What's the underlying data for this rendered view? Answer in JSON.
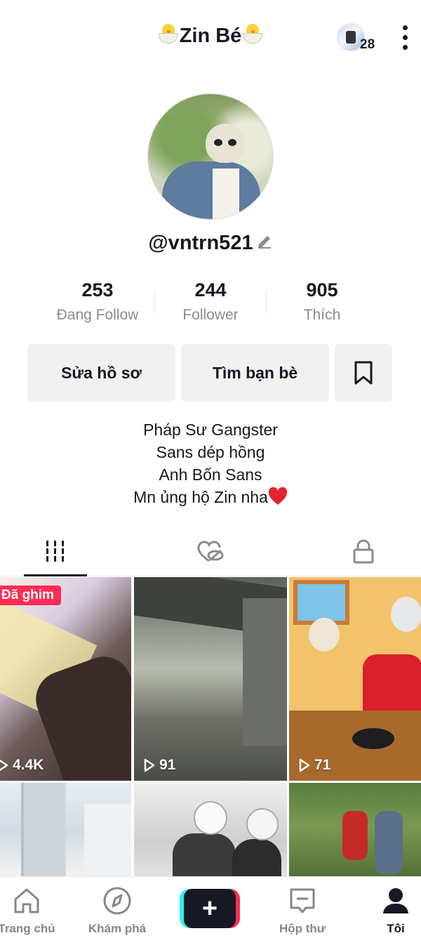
{
  "header": {
    "title": "Zin Bé",
    "notification_count": "28"
  },
  "profile": {
    "handle": "@vntrn521"
  },
  "stats": [
    {
      "value": "253",
      "label": "Đang Follow"
    },
    {
      "value": "244",
      "label": "Follower"
    },
    {
      "value": "905",
      "label": "Thích"
    }
  ],
  "buttons": {
    "edit_profile": "Sửa hồ sơ",
    "find_friends": "Tìm bạn bè"
  },
  "bio": [
    "Pháp Sư Gangster",
    "Sans dép hồng",
    "Anh Bốn Sans",
    "Mn ủng hộ Zin nha"
  ],
  "videos": [
    {
      "pinned_label": "Đã ghim",
      "views": "4.4K"
    },
    {
      "views": "91"
    },
    {
      "views": "71"
    },
    {},
    {},
    {}
  ],
  "nav": [
    {
      "label": "Trang chủ"
    },
    {
      "label": "Khám phá"
    },
    {
      "label": ""
    },
    {
      "label": "Hộp thư"
    },
    {
      "label": "Tôi"
    }
  ],
  "colors": {
    "accent": "#fe2c55",
    "cyan": "#25f4ee",
    "text": "#161823",
    "muted": "#8a8b91"
  },
  "icons": [
    "chick-emoji",
    "more-vertical-icon",
    "pencil-icon",
    "bookmark-icon",
    "grid-icon",
    "liked-hidden-icon",
    "lock-icon",
    "play-icon",
    "home-icon",
    "compass-icon",
    "plus-icon",
    "inbox-icon",
    "profile-icon",
    "heart-emoji"
  ]
}
